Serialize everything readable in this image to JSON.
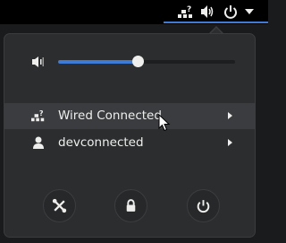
{
  "topbar": {
    "icons": [
      "network-wired-acquiring-icon",
      "speaker-volume-icon",
      "power-icon",
      "menu-arrow-icon"
    ]
  },
  "volume": {
    "icon": "speaker-volume-icon",
    "level": 0.45
  },
  "menu": {
    "items": [
      {
        "label": "Wired Connected",
        "icon": "network-wired-acquiring-icon",
        "hovered": true
      },
      {
        "label": "devconnected",
        "icon": "user-icon",
        "hovered": false
      }
    ]
  },
  "actions": [
    {
      "name": "settings",
      "icon": "settings-tools-icon"
    },
    {
      "name": "lock",
      "icon": "lock-icon"
    },
    {
      "name": "power-off",
      "icon": "power-icon"
    }
  ],
  "colors": {
    "accent": "#3e7bd6",
    "menu_bg": "#2b2d2f",
    "topbar_bg": "#000000",
    "text": "#eeeeec"
  }
}
